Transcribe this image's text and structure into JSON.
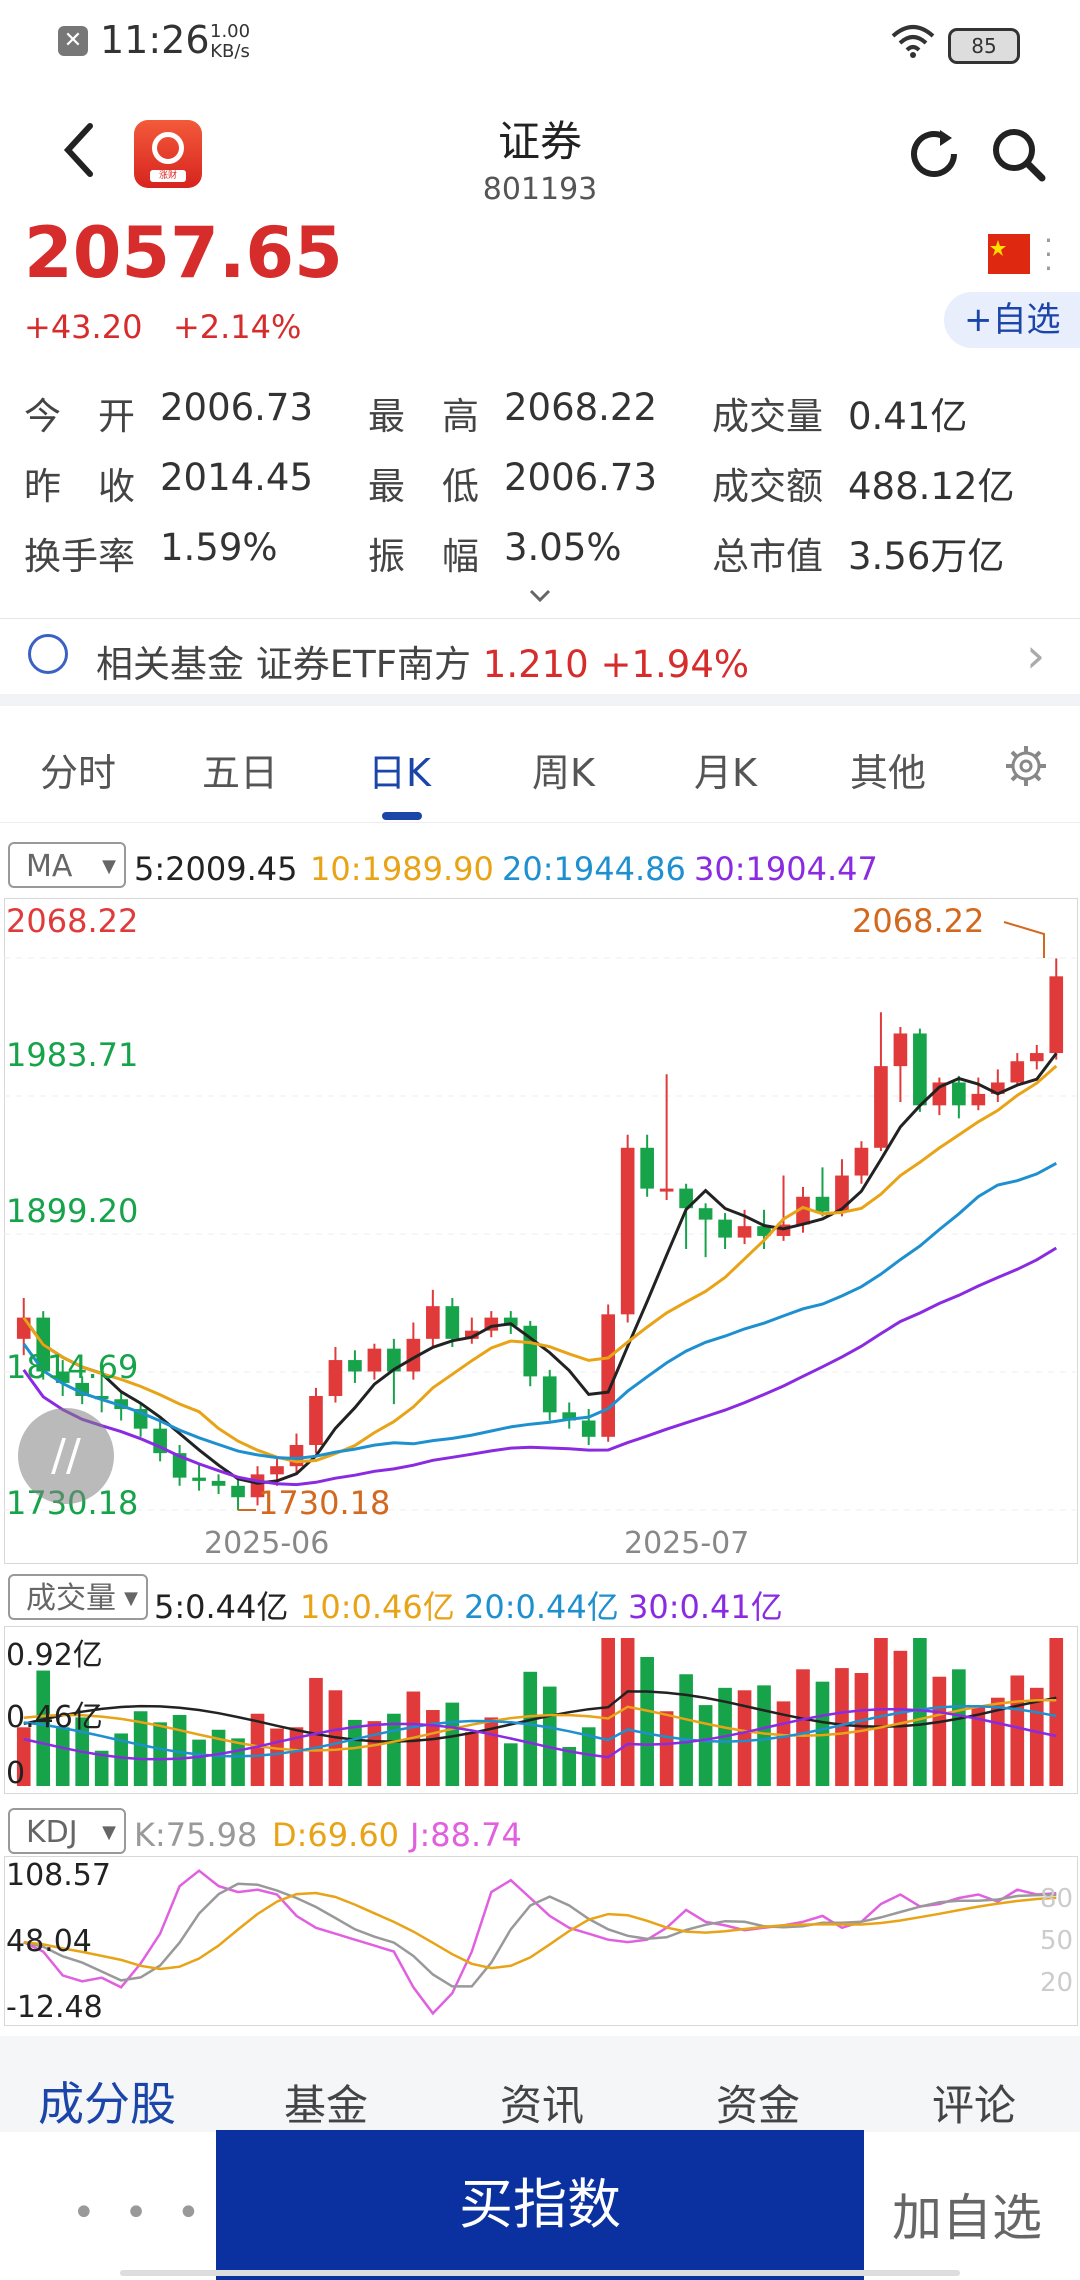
{
  "status_bar": {
    "time": "11:26",
    "speed_value": "1.00",
    "speed_unit": "KB/s",
    "battery": "85"
  },
  "header": {
    "title": "证券",
    "code": "801193",
    "logo_tag": "涨财"
  },
  "quote": {
    "price": "2057.65",
    "change": "+43.20",
    "change_pct": "+2.14%",
    "add_watch": "+自选"
  },
  "stats": [
    {
      "label": "今　开",
      "value": "2006.73"
    },
    {
      "label": "最　高",
      "value": "2068.22"
    },
    {
      "label": "成交量",
      "value": "0.41亿"
    },
    {
      "label": "昨　收",
      "value": "2014.45"
    },
    {
      "label": "最　低",
      "value": "2006.73"
    },
    {
      "label": "成交额",
      "value": "488.12亿"
    },
    {
      "label": "换手率",
      "value": "1.59%"
    },
    {
      "label": "振　幅",
      "value": "3.05%"
    },
    {
      "label": "总市值",
      "value": "3.56万亿"
    }
  ],
  "fund": {
    "label": "相关基金",
    "name": "证券ETF南方",
    "price": "1.210",
    "change_pct": "+1.94%"
  },
  "tabs": [
    "分时",
    "五日",
    "日K",
    "周K",
    "月K",
    "其他"
  ],
  "active_tab": "日K",
  "ma": {
    "select": "MA",
    "ma5": "5:2009.45",
    "ma10": "10:1989.90",
    "ma20": "20:1944.86",
    "ma30": "30:1904.47",
    "colors": {
      "ma5": "#222222",
      "ma10": "#e8a317",
      "ma20": "#1e90d0",
      "ma30": "#8a2be2"
    }
  },
  "price_axis": {
    "top": "2068.22",
    "mid1": "1983.71",
    "mid2": "1899.20",
    "mid3": "1814.69",
    "bottom": "1730.18"
  },
  "annotations": {
    "high": "2068.22",
    "low": "1730.18"
  },
  "date_axis": {
    "d1": "2025-06",
    "d2": "2025-07"
  },
  "volume": {
    "select": "成交量",
    "ma5": "5:0.44亿",
    "ma10": "10:0.46亿",
    "ma20": "20:0.44亿",
    "ma30": "30:0.41亿",
    "axis": {
      "top": "0.92亿",
      "mid": "0.46亿",
      "bottom": "0"
    }
  },
  "kdj": {
    "select": "KDJ",
    "k": "K:75.98",
    "d": "D:69.60",
    "j": "J:88.74",
    "axis": {
      "top": "108.57",
      "mid": "48.04",
      "bottom": "-12.48"
    },
    "right_axis": [
      "80",
      "50",
      "20"
    ]
  },
  "bottom_tabs": [
    "成分股",
    "基金",
    "资讯",
    "资金",
    "评论"
  ],
  "bottom_bar": {
    "more": "• • •",
    "buy": "买指数",
    "add": "加自选"
  },
  "colors": {
    "up": "#e03a3a",
    "down": "#16a34a",
    "accent": "#1b45a8"
  },
  "chart_data": {
    "type": "candlestick",
    "candles": [
      [
        1835,
        1848,
        1860,
        1825
      ],
      [
        1848,
        1815,
        1852,
        1810
      ],
      [
        1815,
        1808,
        1822,
        1800
      ],
      [
        1808,
        1800,
        1812,
        1795
      ],
      [
        1800,
        1798,
        1815,
        1790
      ],
      [
        1798,
        1792,
        1802,
        1785
      ],
      [
        1792,
        1780,
        1796,
        1775
      ],
      [
        1780,
        1765,
        1785,
        1760
      ],
      [
        1765,
        1750,
        1770,
        1745
      ],
      [
        1750,
        1748,
        1758,
        1742
      ],
      [
        1748,
        1745,
        1752,
        1740
      ],
      [
        1745,
        1738,
        1750,
        1730
      ],
      [
        1738,
        1752,
        1757,
        1733
      ],
      [
        1752,
        1757,
        1762,
        1745
      ],
      [
        1757,
        1770,
        1777,
        1752
      ],
      [
        1770,
        1800,
        1805,
        1765
      ],
      [
        1800,
        1822,
        1830,
        1796
      ],
      [
        1822,
        1815,
        1828,
        1808
      ],
      [
        1815,
        1829,
        1832,
        1810
      ],
      [
        1829,
        1815,
        1835,
        1795
      ],
      [
        1815,
        1835,
        1845,
        1810
      ],
      [
        1835,
        1855,
        1865,
        1830
      ],
      [
        1855,
        1835,
        1860,
        1830
      ],
      [
        1835,
        1840,
        1848,
        1832
      ],
      [
        1840,
        1848,
        1852,
        1836
      ],
      [
        1848,
        1843,
        1852,
        1838
      ],
      [
        1843,
        1812,
        1846,
        1806
      ],
      [
        1812,
        1790,
        1816,
        1785
      ],
      [
        1790,
        1785,
        1796,
        1780
      ],
      [
        1785,
        1775,
        1792,
        1770
      ],
      [
        1775,
        1850,
        1856,
        1772
      ],
      [
        1850,
        1952,
        1960,
        1845
      ],
      [
        1952,
        1927,
        1960,
        1922
      ],
      [
        1927,
        1927,
        1997,
        1920
      ],
      [
        1927,
        1915,
        1930,
        1890
      ],
      [
        1915,
        1908,
        1918,
        1885
      ],
      [
        1908,
        1897,
        1912,
        1890
      ],
      [
        1897,
        1904,
        1914,
        1893
      ],
      [
        1904,
        1898,
        1914,
        1890
      ],
      [
        1898,
        1905,
        1935,
        1895
      ],
      [
        1905,
        1922,
        1928,
        1900
      ],
      [
        1922,
        1913,
        1940,
        1910
      ],
      [
        1913,
        1935,
        1945,
        1910
      ],
      [
        1935,
        1952,
        1956,
        1930
      ],
      [
        1952,
        2002,
        2035,
        1950
      ],
      [
        2002,
        2022,
        2026,
        1980
      ],
      [
        2022,
        1978,
        2025,
        1974
      ],
      [
        1978,
        1992,
        1995,
        1972
      ],
      [
        1992,
        1978,
        1996,
        1970
      ],
      [
        1978,
        1985,
        1995,
        1975
      ],
      [
        1985,
        1992,
        2000,
        1980
      ],
      [
        1992,
        2005,
        2010,
        1990
      ],
      [
        2005,
        2010,
        2015,
        2000
      ],
      [
        2010,
        2057,
        2068,
        2006
      ]
    ],
    "ylim": [
      1730.18,
      2068.22
    ]
  }
}
